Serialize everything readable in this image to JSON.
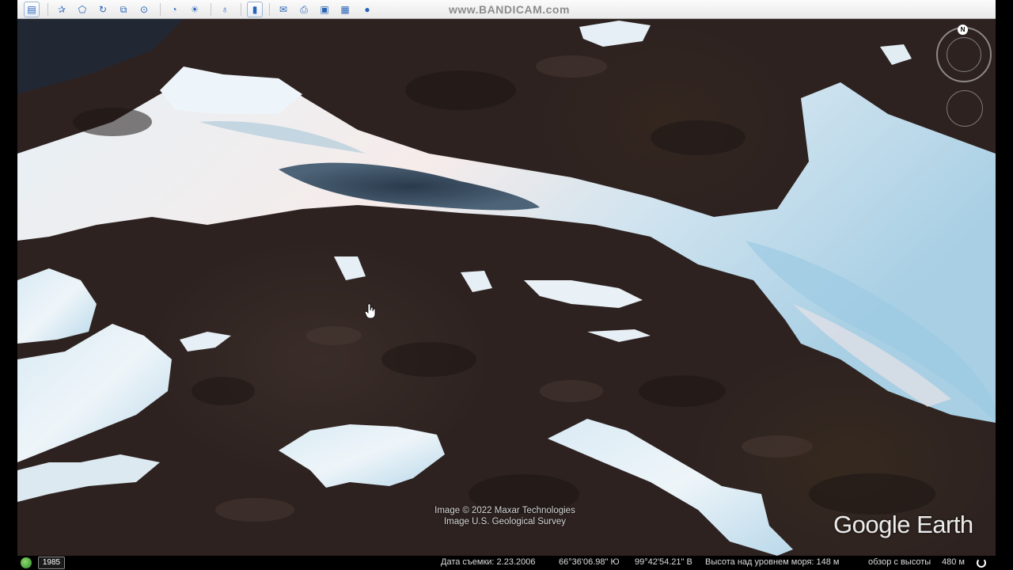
{
  "watermark": "www.BANDICAM.com",
  "toolbar": {
    "buttons": [
      {
        "name": "sidebar-toggle-icon",
        "glyph": "▤"
      },
      {
        "name": "add-placemark-icon",
        "glyph": "✰"
      },
      {
        "name": "add-polygon-icon",
        "glyph": "⬠"
      },
      {
        "name": "add-path-icon",
        "glyph": "↻"
      },
      {
        "name": "add-image-overlay-icon",
        "glyph": "⧉"
      },
      {
        "name": "record-tour-icon",
        "glyph": "⊙"
      },
      {
        "name": "historical-imagery-icon",
        "glyph": "◔"
      },
      {
        "name": "sunlight-icon",
        "glyph": "☀"
      },
      {
        "name": "switch-planet-icon",
        "glyph": "♁"
      },
      {
        "name": "ruler-icon",
        "glyph": "▮"
      },
      {
        "name": "email-icon",
        "glyph": "✉"
      },
      {
        "name": "print-icon",
        "glyph": "⎙"
      },
      {
        "name": "save-image-icon",
        "glyph": "▣"
      },
      {
        "name": "view-in-maps-icon",
        "glyph": "▦"
      },
      {
        "name": "earth-gallery-icon",
        "glyph": "●"
      }
    ]
  },
  "map": {
    "attribution_line1": "Image © 2022 Maxar Technologies",
    "attribution_line2": "Image U.S. Geological Survey",
    "logo": "Google Earth",
    "north_label": "N"
  },
  "status": {
    "year": "1985",
    "date": "Дата съемки: 2.23.2006",
    "lat": "66°36'06.98\" Ю",
    "lon": "99°42'54.21\" В",
    "elevation": "Высота над уровнем моря:  148 м",
    "eye_alt": "обзор с высоты",
    "eye_alt_value": "480 м"
  },
  "colors": {
    "rock": "#2d2220",
    "snow": "#e8f1f7",
    "ice_blue": "#9fc6dc",
    "toolbar_accent": "#2a64b8"
  }
}
